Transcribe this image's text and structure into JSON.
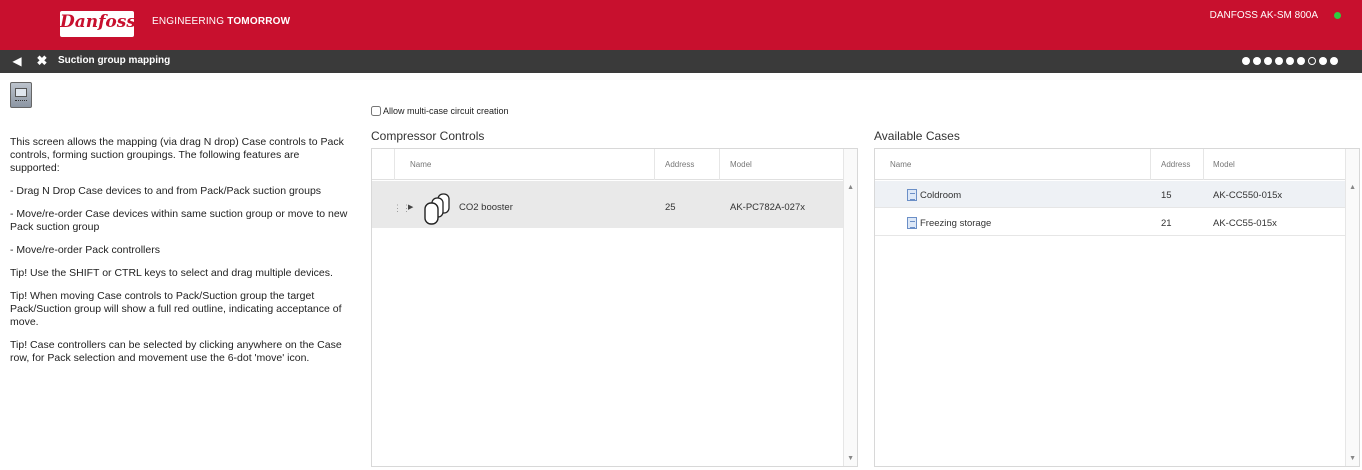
{
  "brand": {
    "logo_text": "Danfoss",
    "tagline_prefix": "ENGINEERING ",
    "tagline_bold": "TOMORROW",
    "device_name": "DANFOSS AK-SM 800A",
    "status_color": "#2ecc40",
    "accent_color": "#c8102e"
  },
  "nav": {
    "back_icon": "back-arrow-icon",
    "close_icon": "close-icon",
    "title": "Suction group mapping",
    "pager_dots": 9,
    "pager_current": 8
  },
  "description": {
    "intro": "This screen allows the mapping (via drag N drop) Case controls to Pack controls, forming suction groupings. The following features are supported:",
    "feature1": "- Drag N Drop Case devices to and from Pack/Pack suction groups",
    "feature2": "- Move/re-order Case devices within same suction group or move to new Pack suction group",
    "feature3": "- Move/re-order Pack controllers",
    "tip1": "Tip! Use the SHIFT or CTRL keys to select and drag multiple devices.",
    "tip2": "Tip! When moving Case controls to Pack/Suction group the target Pack/Suction group will show a full red outline, indicating acceptance of move.",
    "tip3": "Tip! Case controllers can be selected by clicking anywhere on the Case row, for Pack selection and movement use the 6-dot 'move' icon."
  },
  "options": {
    "multi_case_label": "Allow multi-case circuit creation",
    "multi_case_checked": false
  },
  "compressor": {
    "title": "Compressor Controls",
    "columns": {
      "name": "Name",
      "address": "Address",
      "model": "Model"
    },
    "rows": [
      {
        "name": "CO2 booster",
        "address": "25",
        "model": "AK-PC782A-027x"
      }
    ]
  },
  "cases": {
    "title": "Available Cases",
    "columns": {
      "name": "Name",
      "address": "Address",
      "model": "Model"
    },
    "rows": [
      {
        "name": "Coldroom",
        "address": "15",
        "model": "AK-CC550-015x"
      },
      {
        "name": "Freezing storage",
        "address": "21",
        "model": "AK-CC55-015x"
      }
    ]
  }
}
